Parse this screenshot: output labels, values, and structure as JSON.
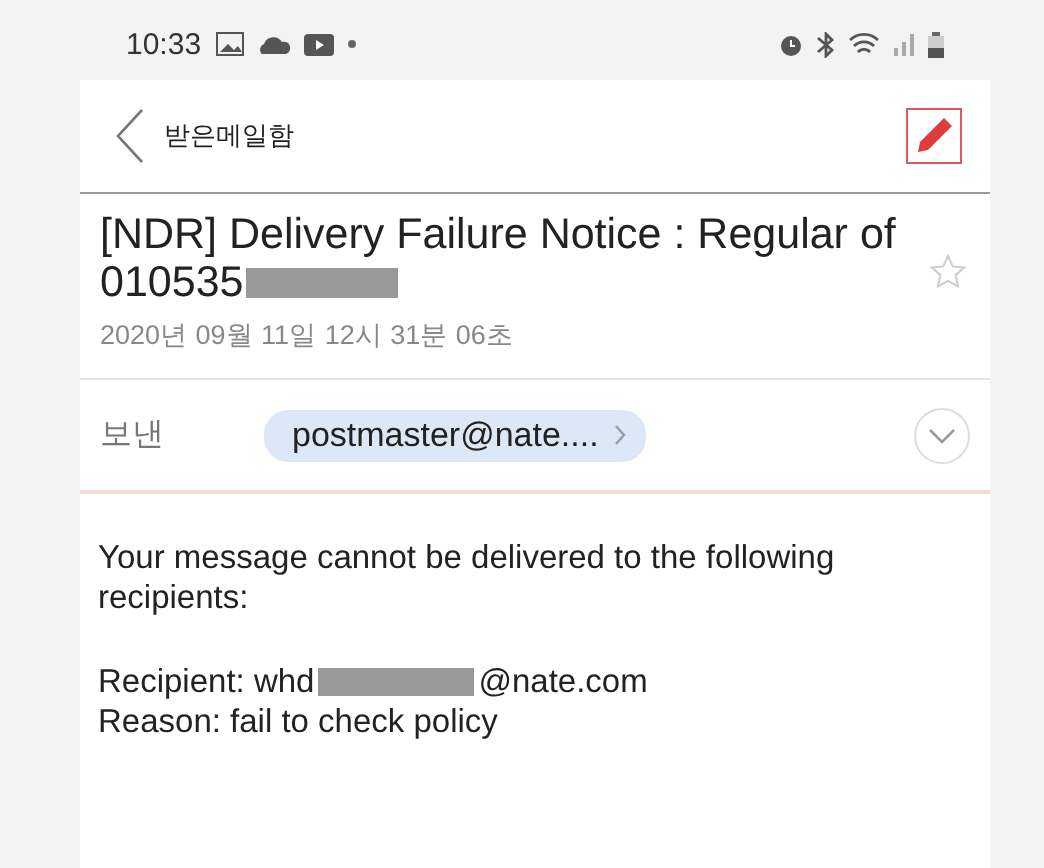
{
  "status_bar": {
    "time": "10:33"
  },
  "header": {
    "back_label": "받은메일함"
  },
  "message": {
    "subject": "[NDR] Delivery Failure Notice : Regular of 010535",
    "subject_redacted": true,
    "starred": false,
    "date": "2020년 09월 11일 12시 31분 06초",
    "sender_label": "보낸",
    "sender": "postmaster@nate....",
    "expanded": false
  },
  "body": {
    "intro": "Your message cannot be delivered to the following recipients:",
    "recipient_prefix": "Recipient: whd",
    "recipient_redacted": true,
    "recipient_suffix": "@nate.com",
    "reason": "Reason: fail to check policy"
  }
}
